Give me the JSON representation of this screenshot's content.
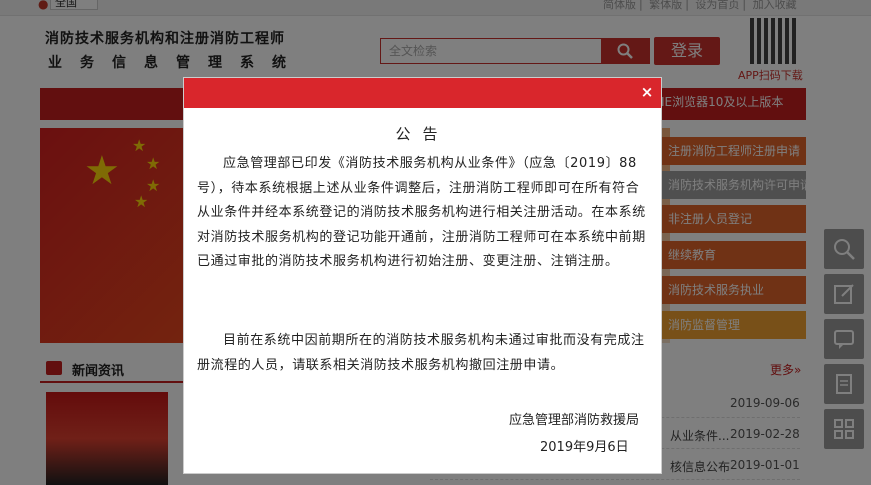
{
  "topbar": {
    "location_icon": "location-pin-icon",
    "region": "全国",
    "links": [
      "简体版",
      "繁体版",
      "设为首页",
      "加入收藏"
    ]
  },
  "header": {
    "title_line1": "消防技术服务机构和注册消防工程师",
    "title_line2": "业务信息管理系统",
    "search_placeholder": "全文检索",
    "search_icon": "search-icon",
    "login_label": "登录",
    "qr_label": "APP扫码下载"
  },
  "banner_note": "IE浏览器10及以上版本",
  "menu": [
    "注册消防工程师注册申请",
    "消防技术服务机构许可申请",
    "非注册人员登记",
    "继续教育",
    "消防技术服务执业",
    "消防监督管理"
  ],
  "news": {
    "title": "新闻资讯",
    "more": "更多»",
    "rows": [
      {
        "title": "",
        "date": "2019-09-06"
      },
      {
        "title": "从业条件...",
        "date": "2019-02-28"
      },
      {
        "title": "核信息公布",
        "date": "2019-01-01"
      }
    ]
  },
  "side_tools": [
    "search-icon",
    "edit-icon",
    "chat-icon",
    "document-icon",
    "apps-icon"
  ],
  "modal": {
    "close_label": "×",
    "title": "公告",
    "paragraph1": "应急管理部已印发《消防技术服务机构从业条件》（应急〔2019〕88号），待本系统根据上述从业条件调整后，注册消防工程师即可在所有符合从业条件并经本系统登记的消防技术服务机构进行相关注册活动。在本系统对消防技术服务机构的登记功能开通前，注册消防工程师可在本系统中前期已通过审批的消防技术服务机构进行初始注册、变更注册、注销注册。",
    "paragraph2": "目前在系统中因前期所在的消防技术服务机构未通过审批而没有完成注册流程的人员，请联系相关消防技术服务机构撤回注册申请。",
    "signature": "应急管理部消防救援局",
    "date": "2019年9月6日"
  }
}
